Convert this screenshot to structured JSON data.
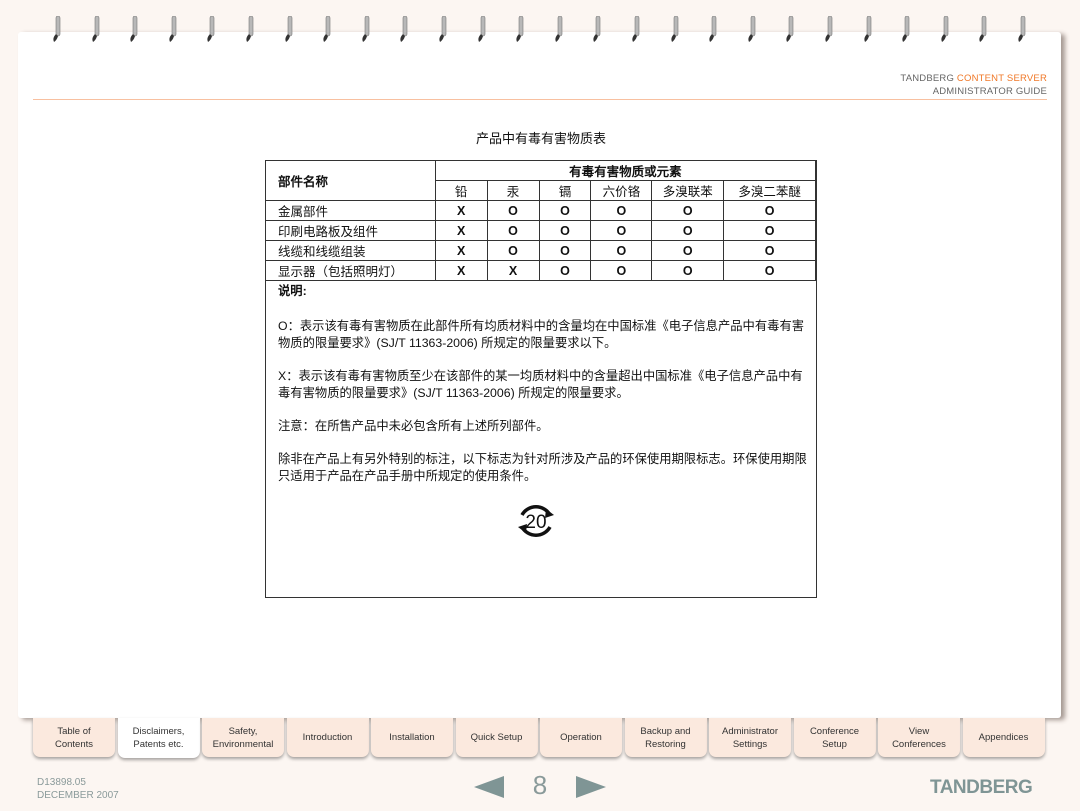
{
  "header": {
    "brand": "TANDBERG",
    "product": "CONTENT SERVER",
    "guide": "ADMINISTRATOR GUIDE",
    "accent_color": "#f07828"
  },
  "document": {
    "title": "产品中有毒有害物质表",
    "table": {
      "part_header": "部件名称",
      "group_header": "有毒有害物质或元素",
      "columns": [
        "铅",
        "汞",
        "镉",
        "六价铬",
        "多溴联苯",
        "多溴二苯醚"
      ],
      "rows": [
        {
          "part": "金属部件",
          "values": [
            "X",
            "O",
            "O",
            "O",
            "O",
            "O"
          ]
        },
        {
          "part": "印刷电路板及组件",
          "values": [
            "X",
            "O",
            "O",
            "O",
            "O",
            "O"
          ]
        },
        {
          "part": "线缆和线缆组装",
          "values": [
            "X",
            "O",
            "O",
            "O",
            "O",
            "O"
          ]
        },
        {
          "part": "显示器（包括照明灯）",
          "values": [
            "X",
            "X",
            "O",
            "O",
            "O",
            "O"
          ]
        }
      ]
    },
    "notes_heading": "说明:",
    "notes": [
      "O：表示该有毒有害物质在此部件所有均质材料中的含量均在中国标准《电子信息产品中有毒有害物质的限量要求》(SJ/T 11363-2006) 所规定的限量要求以下。",
      "X：表示该有毒有害物质至少在该部件的某一均质材料中的含量超出中国标准《电子信息产品中有毒有害物质的限量要求》(SJ/T 11363-2006) 所规定的限量要求。",
      "注意：在所售产品中未必包含所有上述所列部件。",
      "除非在产品上有另外特别的标注，以下标志为针对所涉及产品的环保使用期限标志。环保使用期限只适用于产品在产品手册中所规定的使用条件。"
    ],
    "epup_logo": "20"
  },
  "tabs": [
    {
      "label": "Table of Contents"
    },
    {
      "label": "Disclaimers, Patents etc.",
      "active": true
    },
    {
      "label": "Safety, Environmental"
    },
    {
      "label": "Introduction"
    },
    {
      "label": "Installation"
    },
    {
      "label": "Quick Setup"
    },
    {
      "label": "Operation"
    },
    {
      "label": "Backup and Restoring"
    },
    {
      "label": "Administrator Settings"
    },
    {
      "label": "Conference Setup"
    },
    {
      "label": "View Conferences"
    },
    {
      "label": "Appendices"
    }
  ],
  "footer": {
    "doc_id": "D13898.05",
    "date": "DECEMBER 2007",
    "page": "8",
    "logo": "TANDBERG"
  }
}
